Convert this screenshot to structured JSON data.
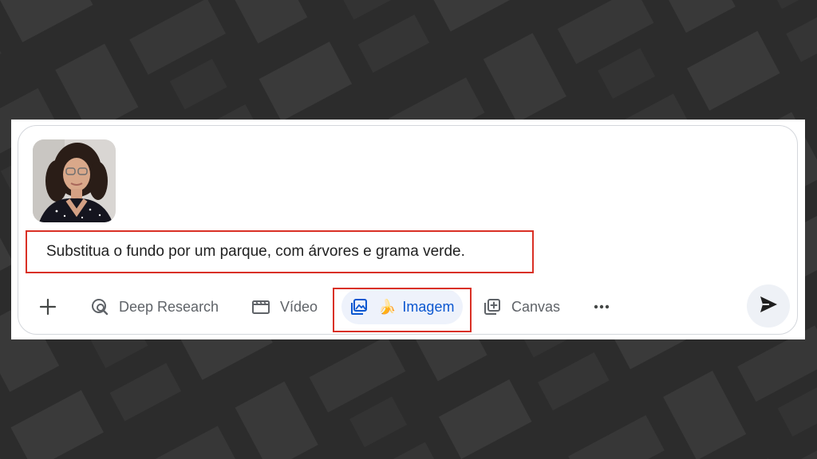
{
  "composer": {
    "attachment": {
      "type": "image",
      "description": "photo"
    },
    "prompt_text": "Substitua o fundo por um parque, com árvores e grama verde."
  },
  "toolbar": {
    "add_icon": "plus-icon",
    "deep_research": {
      "label": "Deep Research",
      "icon": "search-globe-icon"
    },
    "video": {
      "label": "Vídeo",
      "icon": "clapperboard-icon"
    },
    "image": {
      "label": "Imagem",
      "icon": "image-stack-icon",
      "badge_icon": "banana-icon",
      "badge_glyph": "🍌",
      "active": true
    },
    "canvas": {
      "label": "Canvas",
      "icon": "canvas-add-icon"
    },
    "more_icon": "more-horizontal-icon",
    "send_icon": "send-icon"
  },
  "colors": {
    "background": "#2e2e2e",
    "pattern": "#3a3a3a",
    "highlight_border": "#d93025",
    "active_chip_bg": "#eef2fb",
    "active_chip_text": "#0b57d0",
    "toolbar_text": "#5f6368"
  }
}
